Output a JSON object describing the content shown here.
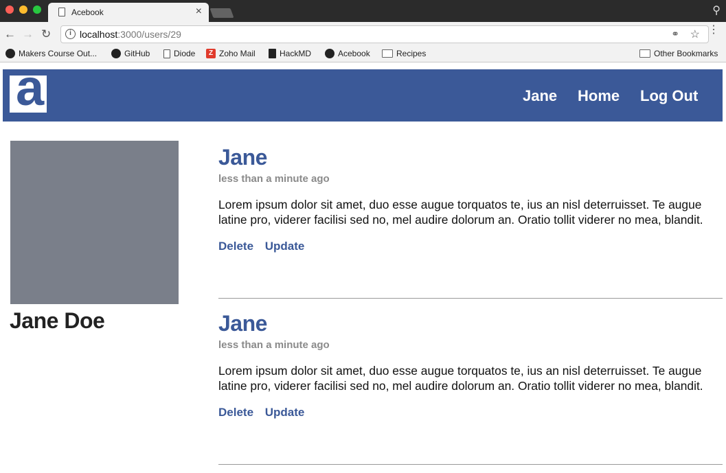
{
  "browser": {
    "tab_title": "Acebook",
    "tab_close": "×",
    "url_host": "localhost",
    "url_path": ":3000/users/29",
    "bookmarks": [
      {
        "label": "Makers Course Out...",
        "icon": "github-icon"
      },
      {
        "label": "GitHub",
        "icon": "github-icon"
      },
      {
        "label": "Diode",
        "icon": "document-icon"
      },
      {
        "label": "Zoho Mail",
        "icon": "zoho-icon"
      },
      {
        "label": "HackMD",
        "icon": "document-filled-icon"
      },
      {
        "label": "Acebook",
        "icon": "github-icon"
      },
      {
        "label": "Recipes",
        "icon": "folder-icon"
      }
    ],
    "other_bookmarks": "Other Bookmarks"
  },
  "header": {
    "logo_letter": "a",
    "nav": [
      "Jane",
      "Home",
      "Log Out"
    ],
    "brand_color": "#3b5998"
  },
  "profile": {
    "name": "Jane Doe"
  },
  "posts": [
    {
      "author": "Jane",
      "time": "less than a minute ago",
      "body": "Lorem ipsum dolor sit amet, duo esse augue torquatos te, ius an nisl deterruisset. Te augue latine pro, viderer facilisi sed no, mel audire dolorum an. Oratio tollit viderer no mea, blandit.",
      "delete_label": "Delete",
      "update_label": "Update"
    },
    {
      "author": "Jane",
      "time": "less than a minute ago",
      "body": "Lorem ipsum dolor sit amet, duo esse augue torquatos te, ius an nisl deterruisset. Te augue latine pro, viderer facilisi sed no, mel audire dolorum an. Oratio tollit viderer no mea, blandit.",
      "delete_label": "Delete",
      "update_label": "Update"
    }
  ]
}
